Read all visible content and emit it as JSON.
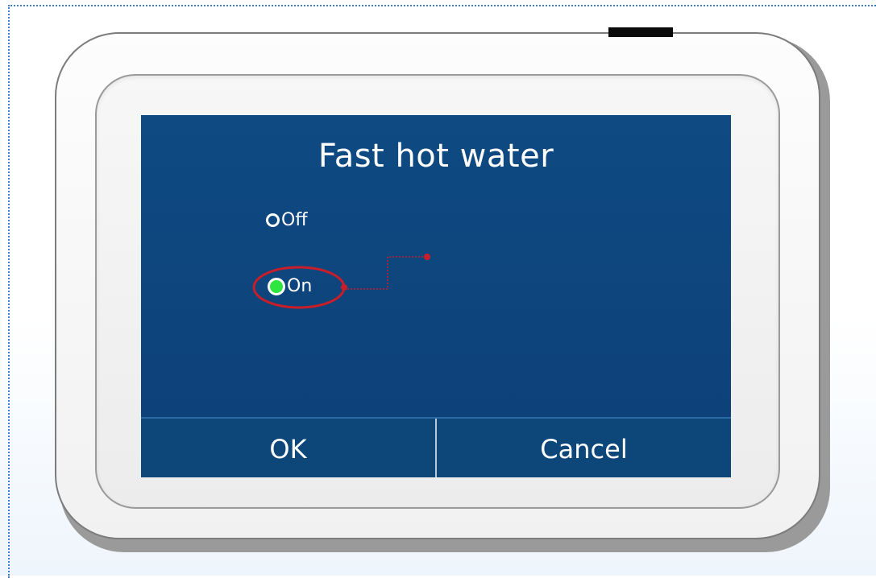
{
  "dialog": {
    "title": "Fast hot water",
    "options": [
      {
        "label": "Off",
        "selected": false
      },
      {
        "label": "On",
        "selected": true
      }
    ],
    "ok_label": "OK",
    "cancel_label": "Cancel"
  },
  "colors": {
    "screen_background": "#0f4a82",
    "selected_radio": "#2ee63f",
    "annotation": "#c81e2a"
  }
}
